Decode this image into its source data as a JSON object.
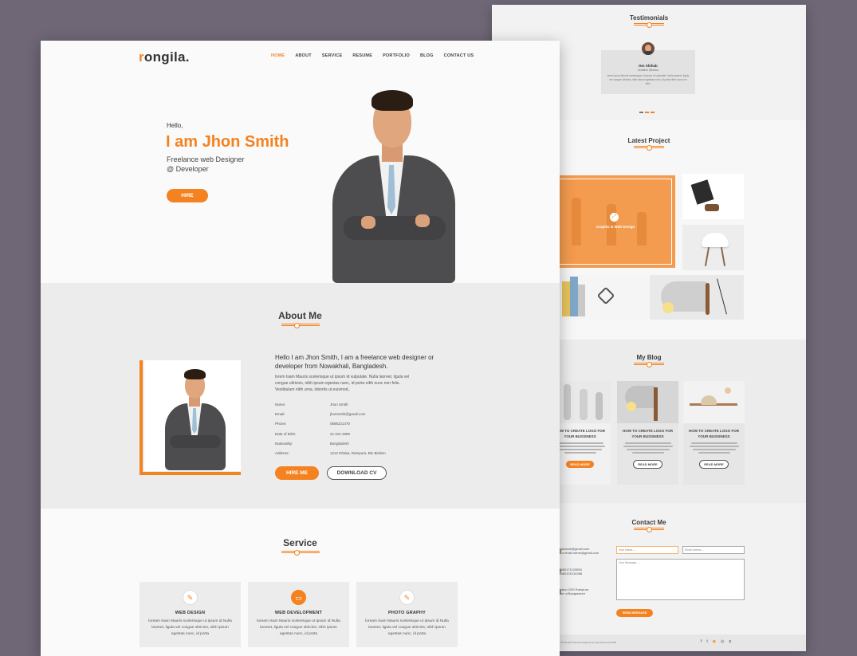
{
  "colors": {
    "accent": "#f58220",
    "background": "#706776"
  },
  "back": {
    "testimonials": {
      "title": "Testimonials",
      "person": "Hm Shihab",
      "role": "Creative Director",
      "text": "lorem Ipum Mauris scelerisque ut ipsum id vulputate. Nulla laoreet, ligula vel congue ultricies, nibh ipsum egestas nunc, id porta nibh nunc non felis."
    },
    "project": {
      "title": "Latest Project",
      "hover_label": "Graphic & Web Design"
    },
    "blog": {
      "title": "My Blog",
      "posts": [
        {
          "title": "HOW TO CREATE LOGO FOR YOUR BUSSINESS",
          "button": "READ MORE"
        },
        {
          "title": "HOW TO CREATE LOGO FOR YOUR BUSSINESS",
          "button": "READ MORE"
        },
        {
          "title": "HOW TO CREATE LOGO FOR YOUR BUSSINESS",
          "button": "READ MORE"
        }
      ]
    },
    "contact": {
      "title": "Contact Me",
      "email1": "Rsjdname@gmail.com",
      "email2": "Your email name@gmail.com",
      "phone1": "01680171103556",
      "phone2": "01680101015388",
      "addr1": "Dhaka 1205 Rampura",
      "addr2": "Hale ut Bangladesh",
      "name_ph": "Your Name.....",
      "email_ph": "Email Adress.....",
      "msg_ph": "Your Message.....",
      "send": "SEND MESSAGE",
      "copyright": "© Personal Portfolio Designed by Sayl Fhama at 2018"
    }
  },
  "front": {
    "logo_first": "r",
    "logo_rest": "ongila.",
    "nav": [
      "HOME",
      "ABOUT",
      "SERVICE",
      "RESUME",
      "PORTFOLIO",
      "BLOG",
      "CONTACT US"
    ],
    "hero": {
      "hello": "Hello,",
      "name": "I am Jhon Smith",
      "role1": "Freelance web Designer",
      "role2": "@ Developer",
      "hire": "HIRE"
    },
    "about": {
      "title": "About Me",
      "intro": "Hello I am Jhon Smith, I am a freelance web designer or developer from Nowakhali, Bangladesh.",
      "lorem": "lorem Isam Mauris scelerisque ut ipsum id vulputate. Nulla laoreet, ligula vel congue ultricies, nibh ipsum egestas nunc, id porta nibh nunc non felis. Vestibulum nibh urna, lobortis ut euismod,.",
      "info": [
        {
          "k": "Name:",
          "v": "Jhon Smith"
        },
        {
          "k": "Email:",
          "v": "jhonsmith@gmail.com"
        },
        {
          "k": "Phone:",
          "v": "0586221470"
        },
        {
          "k": "Date of Birth:",
          "v": "21-Oct-1990"
        },
        {
          "k": "Nationality:",
          "v": "Bangladesh"
        },
        {
          "k": "Address:",
          "v": "1212 Dhaka, Rampura, Btv Birdem"
        }
      ],
      "hire_me": "HIRE ME",
      "download": "DOWNLOAD CV"
    },
    "service": {
      "title": "Service",
      "items": [
        {
          "title": "WEB DESIGN",
          "icon": "pencil-icon",
          "desc": "loream Isam Mauris scelerisque ut ipsum id Nulla laoreet, ligula vel congue ultricies, nibh ipsum egestas nunc, id porta"
        },
        {
          "title": "WEB DEVELOPMENT",
          "icon": "monitor-icon",
          "desc": "loream Isam Mauris scelerisque ut ipsum id Nulla laoreet, ligula vel congue ultricies, nibh ipsum egestas nunc, id porta"
        },
        {
          "title": "PHOTO GRAPHY",
          "icon": "pencil-icon",
          "desc": "loream Isam Mauris scelerisque ut ipsum id Nulla laoreet, ligula vel congue ultricies, nibh ipsum egestas nunc, id porta"
        }
      ]
    }
  }
}
